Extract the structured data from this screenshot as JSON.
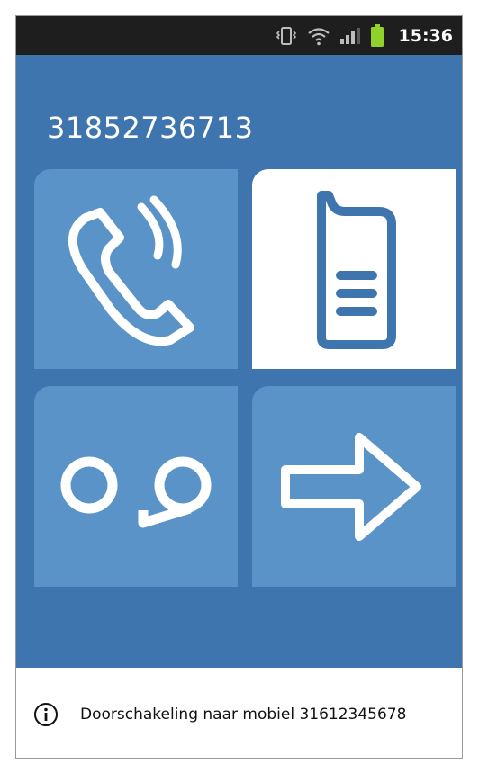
{
  "status_bar": {
    "time": "15:36",
    "icons": [
      "vibrate-icon",
      "wifi-icon",
      "signal-icon",
      "battery-icon"
    ]
  },
  "call": {
    "phone_number": "31852736713"
  },
  "tiles": [
    {
      "id": "call",
      "icon": "phone-handset-icon",
      "selected": false
    },
    {
      "id": "sms",
      "icon": "mobile-message-icon",
      "selected": true
    },
    {
      "id": "voicemail",
      "icon": "voicemail-icon",
      "selected": false
    },
    {
      "id": "forward",
      "icon": "arrow-right-icon",
      "selected": false
    }
  ],
  "footer": {
    "info_text": "Doorschakeling naar mobiel 31612345678"
  },
  "colors": {
    "background": "#3e75ae",
    "tile": "#5a93c8",
    "tile_selected": "#ffffff",
    "status_bar": "#1e1e1e",
    "battery": "#8ed22a"
  }
}
